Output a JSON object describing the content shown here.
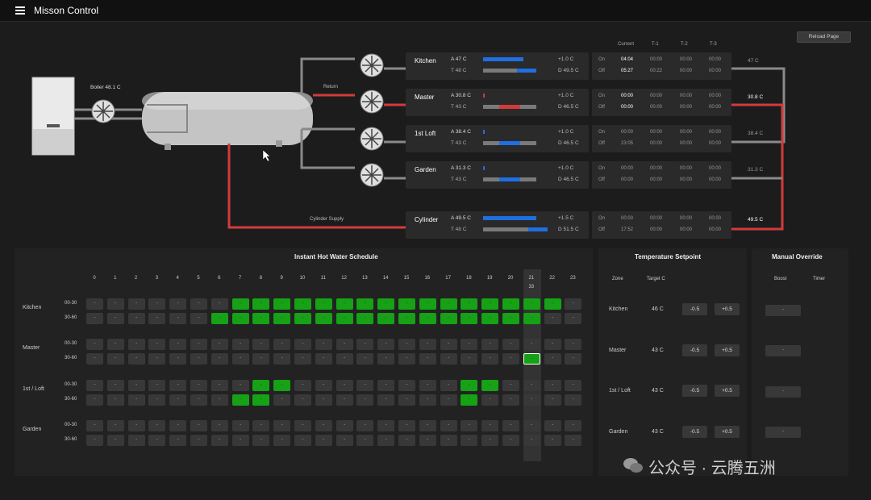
{
  "app": {
    "title": "Misson Control"
  },
  "reload_label": "Reload Page",
  "boiler": {
    "label": "Boiler  48.1 C"
  },
  "pipes": {
    "return_label": "Return",
    "supply_label": "Cylinder Supply"
  },
  "time_headers": [
    "Current",
    "T-1",
    "T-2",
    "T-3"
  ],
  "zones": [
    {
      "name": "Kitchen",
      "actual": "A 47 C",
      "target": "T 48 C",
      "delta": "+1.0 C",
      "diff": "D 49.5 C",
      "on_time": "04:04",
      "off_time": "05:27",
      "t1_on": "00:00",
      "t1_off": "00:22",
      "t2_on": "00:00",
      "t2_off": "00:00",
      "t3_on": "00:00",
      "t3_off": "00:00",
      "outlet": "47 C",
      "hot": false
    },
    {
      "name": "Master",
      "actual": "A 30.8 C",
      "target": "T 43 C",
      "delta": "+1.0 C",
      "diff": "D 46.5 C",
      "on_time": "00:00",
      "off_time": "00:00",
      "t1_on": "00:00",
      "t1_off": "00:00",
      "t2_on": "00:00",
      "t2_off": "00:00",
      "t3_on": "00:00",
      "t3_off": "00:00",
      "outlet": "30.8 C",
      "hot": true
    },
    {
      "name": "1st Loft",
      "actual": "A 38.4 C",
      "target": "T 43 C",
      "delta": "+1.0 C",
      "diff": "D 46.5 C",
      "on_time": "00:00",
      "off_time": "23:05",
      "t1_on": "00:00",
      "t1_off": "00:00",
      "t2_on": "00:00",
      "t2_off": "00:00",
      "t3_on": "00:00",
      "t3_off": "00:00",
      "outlet": "38.4 C",
      "hot": false
    },
    {
      "name": "Garden",
      "actual": "A 31.3 C",
      "target": "T 43 C",
      "delta": "+1.0 C",
      "diff": "D 46.5 C",
      "on_time": "00:00",
      "off_time": "00:00",
      "t1_on": "00:00",
      "t1_off": "00:00",
      "t2_on": "00:00",
      "t2_off": "00:00",
      "t3_on": "00:00",
      "t3_off": "00:00",
      "outlet": "31.3 C",
      "hot": false
    },
    {
      "name": "Cylinder",
      "actual": "A 49.5 C",
      "target": "T 48 C",
      "delta": "+1.5 C",
      "diff": "D 51.5 C",
      "on_time": "00:00",
      "off_time": "17:52",
      "t1_on": "00:00",
      "t1_off": "00:00",
      "t2_on": "00:00",
      "t2_off": "00:00",
      "t3_on": "00:00",
      "t3_off": "00:00",
      "outlet": "49.5 C",
      "hot": true
    }
  ],
  "on_label": "On",
  "off_label": "Off",
  "schedule": {
    "title": "Instant Hot Water Schedule",
    "hours": [
      "0",
      "1",
      "2",
      "3",
      "4",
      "5",
      "6",
      "7",
      "8",
      "9",
      "10",
      "11",
      "12",
      "13",
      "14",
      "15",
      "16",
      "17",
      "18",
      "19",
      "20",
      "21",
      "22",
      "23"
    ],
    "current_hour_index": 21,
    "current_minute": "33",
    "halves": [
      "00-30",
      "30-60"
    ],
    "cell_label": "-",
    "rows": [
      {
        "zone": "Kitchen",
        "a": [
          7,
          8,
          9,
          10,
          11,
          12,
          13,
          14,
          15,
          16,
          17,
          18,
          19,
          20,
          21,
          22
        ],
        "b": [
          6,
          7,
          8,
          9,
          10,
          11,
          12,
          13,
          14,
          15,
          16,
          17,
          18,
          19,
          20,
          21
        ]
      },
      {
        "zone": "Master",
        "a": [],
        "b": [
          21
        ]
      },
      {
        "zone": "1st / Loft",
        "a": [
          8,
          9,
          18,
          19
        ],
        "b": [
          7,
          8,
          18
        ]
      },
      {
        "zone": "Garden",
        "a": [],
        "b": []
      }
    ],
    "selected": {
      "row": 1,
      "half": "b",
      "hour": 21
    }
  },
  "setpoint": {
    "title": "Temperature Setpoint",
    "zone_header": "Zone",
    "target_header": "Target C",
    "minus_label": "-0.5",
    "plus_label": "+0.5",
    "rows": [
      {
        "zone": "Kitchen",
        "target": "46 C"
      },
      {
        "zone": "Master",
        "target": "43 C"
      },
      {
        "zone": "1st / Loft",
        "target": "43 C"
      },
      {
        "zone": "Garden",
        "target": "43 C"
      }
    ]
  },
  "override": {
    "title": "Manual Override",
    "boost_header": "Boost",
    "timer_header": "Timer",
    "button_label": "-"
  },
  "watermark": {
    "text": "公众号 · 云腾五洲"
  },
  "colors": {
    "green": "#16a116",
    "blue": "#1f6fe0",
    "red": "#d23b3b",
    "grey": "#8a8a8a"
  }
}
